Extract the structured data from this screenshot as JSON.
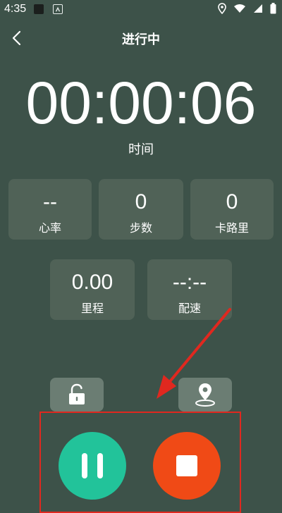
{
  "status_bar": {
    "time": "4:35",
    "icons": [
      "square-icon",
      "font-icon",
      "location-icon",
      "wifi-icon",
      "signal-icon",
      "battery-icon"
    ]
  },
  "header": {
    "title": "进行中",
    "back_icon": "chevron-left-icon"
  },
  "timer": {
    "value": "00:00:06",
    "label": "时间"
  },
  "stats_row1": [
    {
      "value": "--",
      "label": "心率"
    },
    {
      "value": "0",
      "label": "步数"
    },
    {
      "value": "0",
      "label": "卡路里"
    }
  ],
  "stats_row2": [
    {
      "value": "0.00",
      "label": "里程"
    },
    {
      "value": "--:--",
      "label": "配速"
    }
  ],
  "actions": {
    "lock_icon": "unlock-icon",
    "location_icon": "location-pin-icon",
    "pause_icon": "pause-icon",
    "stop_icon": "stop-icon"
  },
  "colors": {
    "background": "#3d5249",
    "card": "#506257",
    "small_button": "#6b7d73",
    "pause": "#22c39a",
    "stop": "#f04a16",
    "annotation": "#e0281f"
  }
}
